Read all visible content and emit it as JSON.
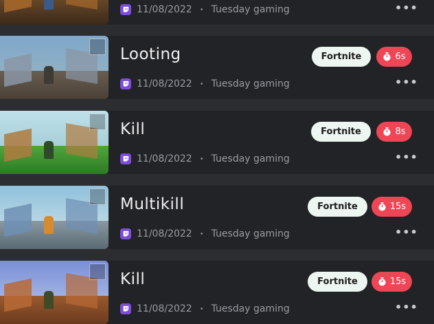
{
  "clips": [
    {
      "title": "",
      "game": "",
      "duration": "",
      "date": "11/08/2022",
      "session": "Tuesday gaming",
      "thumb_theme": "night"
    },
    {
      "title": "Looting",
      "game": "Fortnite",
      "duration": "6s",
      "date": "11/08/2022",
      "session": "Tuesday gaming",
      "thumb_theme": "build"
    },
    {
      "title": "Kill",
      "game": "Fortnite",
      "duration": "8s",
      "date": "11/08/2022",
      "session": "Tuesday gaming",
      "thumb_theme": "grass"
    },
    {
      "title": "Multikill",
      "game": "Fortnite",
      "duration": "15s",
      "date": "11/08/2022",
      "session": "Tuesday gaming",
      "thumb_theme": "sky"
    },
    {
      "title": "Kill",
      "game": "Fortnite",
      "duration": "15s",
      "date": "11/08/2022",
      "session": "Tuesday gaming",
      "thumb_theme": "wood"
    }
  ],
  "icons": {
    "source": "twitch-icon",
    "duration": "stopwatch-icon",
    "menu": "more-options-icon"
  },
  "colors": {
    "game_badge_bg": "#eef6f1",
    "duration_badge_bg": "#ef4656",
    "twitch": "#7d4cdb",
    "card_bg": "#222326"
  },
  "menu_glyph": "•••",
  "separator_glyph": "•"
}
